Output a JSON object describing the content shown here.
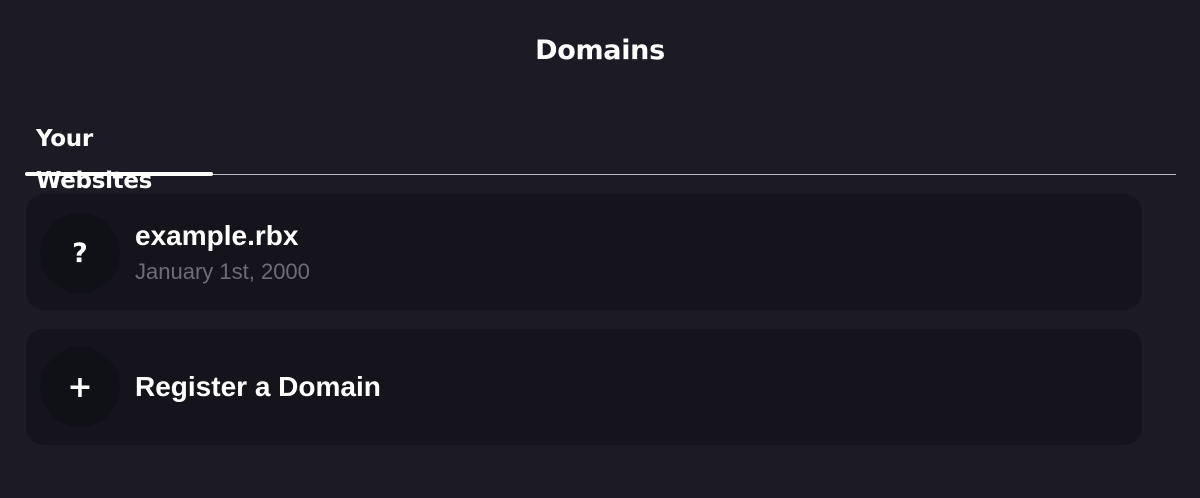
{
  "header": {
    "title": "Domains"
  },
  "tabs": [
    {
      "label": "Your Websites",
      "active": true
    }
  ],
  "domains": [
    {
      "name": "example.rbx",
      "date": "January 1st, 2000",
      "icon": "?",
      "icon_name": "question-mark-icon"
    }
  ],
  "register": {
    "label": "Register a Domain",
    "icon": "+",
    "icon_name": "plus-icon"
  },
  "colors": {
    "background": "#1b1a25",
    "card": "#15141d",
    "avatar": "#101017",
    "muted_text": "#6d6c75",
    "divider": "#bdbcc4",
    "text": "#ffffff"
  }
}
